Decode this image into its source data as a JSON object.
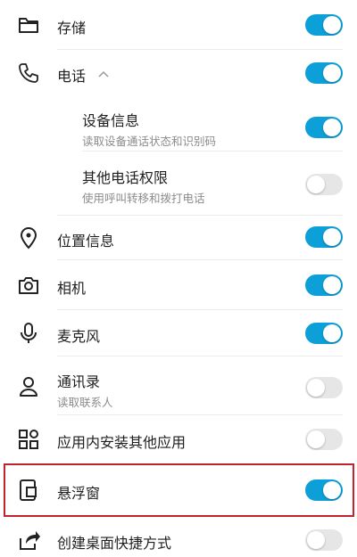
{
  "colors": {
    "accent": "#0d9fd8",
    "toggle_off": "#e6e6e6",
    "highlight": "#c0242f"
  },
  "permissions": [
    {
      "id": "storage",
      "icon": "folder-icon",
      "title": "存储",
      "on": true
    },
    {
      "id": "phone",
      "icon": "phone-icon",
      "title": "电话",
      "expand_icon": "chevron-up-icon",
      "on": true
    },
    {
      "id": "device-info",
      "title": "设备信息",
      "subtitle": "读取设备通话状态和识别码",
      "on": true
    },
    {
      "id": "other-phone",
      "title": "其他电话权限",
      "subtitle": "使用呼叫转移和拨打电话",
      "on": false
    },
    {
      "id": "location",
      "icon": "location-pin-icon",
      "title": "位置信息",
      "on": true
    },
    {
      "id": "camera",
      "icon": "camera-icon",
      "title": "相机",
      "on": true
    },
    {
      "id": "microphone",
      "icon": "microphone-icon",
      "title": "麦克风",
      "on": true
    },
    {
      "id": "contacts",
      "icon": "contacts-icon",
      "title": "通讯录",
      "subtitle": "读取联系人",
      "on": false
    },
    {
      "id": "install-apps",
      "icon": "apps-grid-icon",
      "title": "应用内安装其他应用",
      "on": false
    },
    {
      "id": "floating-window",
      "icon": "floating-window-icon",
      "title": "悬浮窗",
      "on": true,
      "highlighted": true
    },
    {
      "id": "shortcut",
      "icon": "share-icon",
      "title": "创建桌面快捷方式",
      "on": false
    }
  ]
}
